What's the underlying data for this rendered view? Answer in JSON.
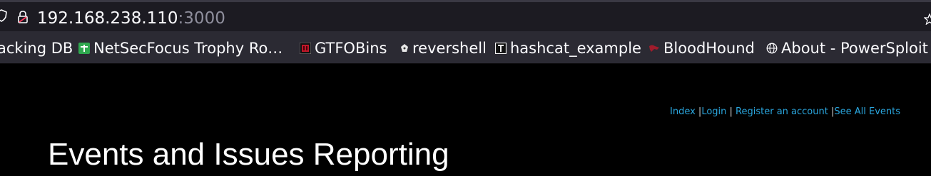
{
  "browser": {
    "url_host": "192.168.238.110",
    "url_port": ":3000",
    "icons": [
      "shield-icon",
      "lock-icon",
      "bookmark-star-icon"
    ]
  },
  "bookmarks": [
    {
      "label": "acking DB",
      "icon": "none"
    },
    {
      "label": "NetSecFocus Trophy Ro…",
      "icon": "green-plus-favicon"
    },
    {
      "label": "GTFOBins",
      "icon": "red-gtfobins-favicon"
    },
    {
      "label": "revershell",
      "icon": "shell-favicon"
    },
    {
      "label": "hashcat_example",
      "icon": "hashcat-favicon"
    },
    {
      "label": "BloodHound",
      "icon": "bloodhound-favicon"
    },
    {
      "label": "About - PowerSploit",
      "icon": "globe-icon"
    }
  ],
  "nav": {
    "index": "Index",
    "sep1": " |",
    "login": "Login",
    "sep2": " | ",
    "register": "Register an account",
    "sep3": " |",
    "see_all": "See All Events"
  },
  "page": {
    "title": "Events and Issues Reporting"
  },
  "colors": {
    "link": "#2aa6de",
    "background": "#000000",
    "toolbar": "#2b2a33"
  }
}
